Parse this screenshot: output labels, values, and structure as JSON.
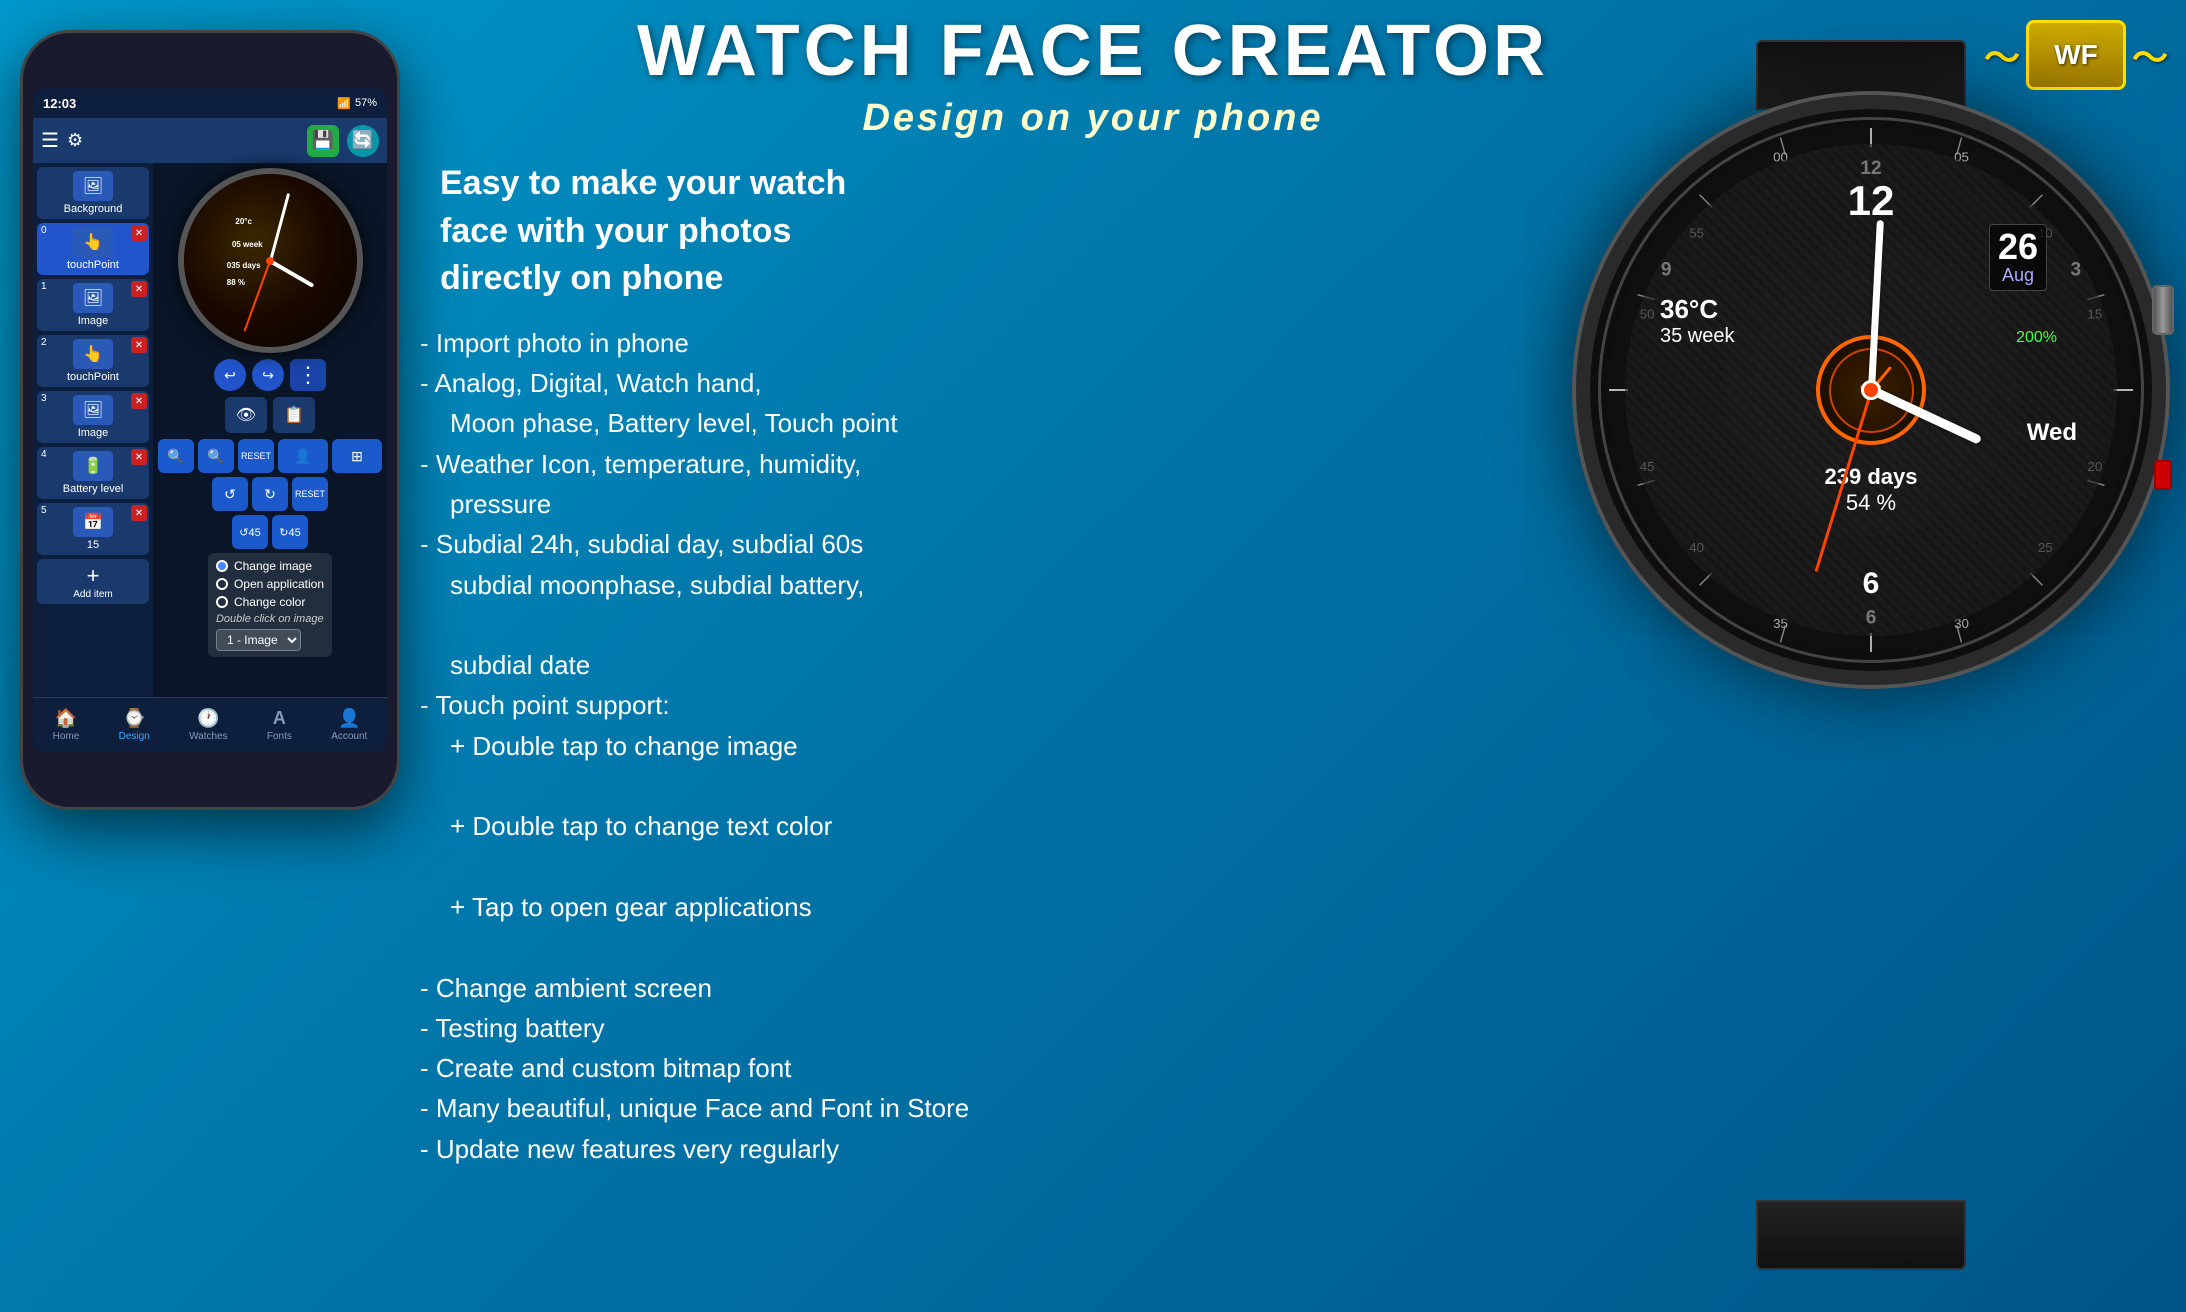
{
  "app": {
    "title": "WATCH FACE CREATOR",
    "subtitle": "Design on your phone"
  },
  "tagline": {
    "line1": "Easy to make your watch",
    "line2": "face with your photos",
    "line3": "directly on phone"
  },
  "features": [
    "- Import photo in phone",
    "- Analog, Digital, Watch hand,\n  Moon phase, Battery level, Touch point",
    "- Weather  Icon, temperature, humidity,\n  pressure",
    "- Subdial 24h, subdial  day, subdial  60s\n  subdial moonphase, subdial  battery,\n  subdial  date",
    "- Touch point support:\n  + Double tap to change image\n  + Double tap to change text color\n  + Tap to open gear applications",
    "- Change ambient screen",
    "- Testing battery",
    "- Create and custom bitmap font",
    "- Many beautiful, unique Face and Font in Store",
    "- Update new features very regularly"
  ],
  "phone": {
    "status": {
      "time": "12:03",
      "battery": "57%"
    },
    "toolbar": {
      "save_label": "💾",
      "refresh_label": "🔄"
    },
    "sidebar": {
      "items": [
        {
          "label": "Background",
          "icon": "🖼",
          "num": ""
        },
        {
          "label": "touchPoint",
          "icon": "👆",
          "num": "0",
          "blue": true
        },
        {
          "label": "Image",
          "icon": "🖼",
          "num": "1"
        },
        {
          "label": "touchPoint",
          "icon": "👆",
          "num": "2"
        },
        {
          "label": "Image",
          "icon": "🖼",
          "num": "3"
        },
        {
          "label": "Battery level",
          "icon": "🔋",
          "num": "4"
        },
        {
          "label": "Add item",
          "icon": "+",
          "num": "5"
        }
      ]
    },
    "controls": {
      "btn1": "🔍",
      "btn2": "🔄",
      "btn3": "RESET",
      "btn4": "↩",
      "btn5": "↪",
      "btn6": "RESET",
      "btn7": "↺",
      "btn8": "↻",
      "btn9": "👤",
      "btn10": "≡"
    },
    "touch_options": {
      "change_image": "Change image",
      "open_application": "Open application",
      "change_color": "Change color",
      "hint": "Double click on image",
      "select_label": "1 - Image"
    },
    "bottom_nav": [
      {
        "label": "Home",
        "icon": "🏠",
        "active": false
      },
      {
        "label": "Design",
        "icon": "⌚",
        "active": true
      },
      {
        "label": "Watches",
        "icon": "🕐",
        "active": false
      },
      {
        "label": "Fonts",
        "icon": "A",
        "active": false
      },
      {
        "label": "Account",
        "icon": "👤",
        "active": false
      }
    ]
  },
  "watch_face": {
    "time": "12",
    "date_num": "26",
    "month": "Aug",
    "temp": "36°C",
    "week": "35 week",
    "days": "239 days",
    "battery": "54 %",
    "day_name": "Wed",
    "battery_icon_pct": "200%"
  },
  "logo": {
    "text": "WF"
  }
}
